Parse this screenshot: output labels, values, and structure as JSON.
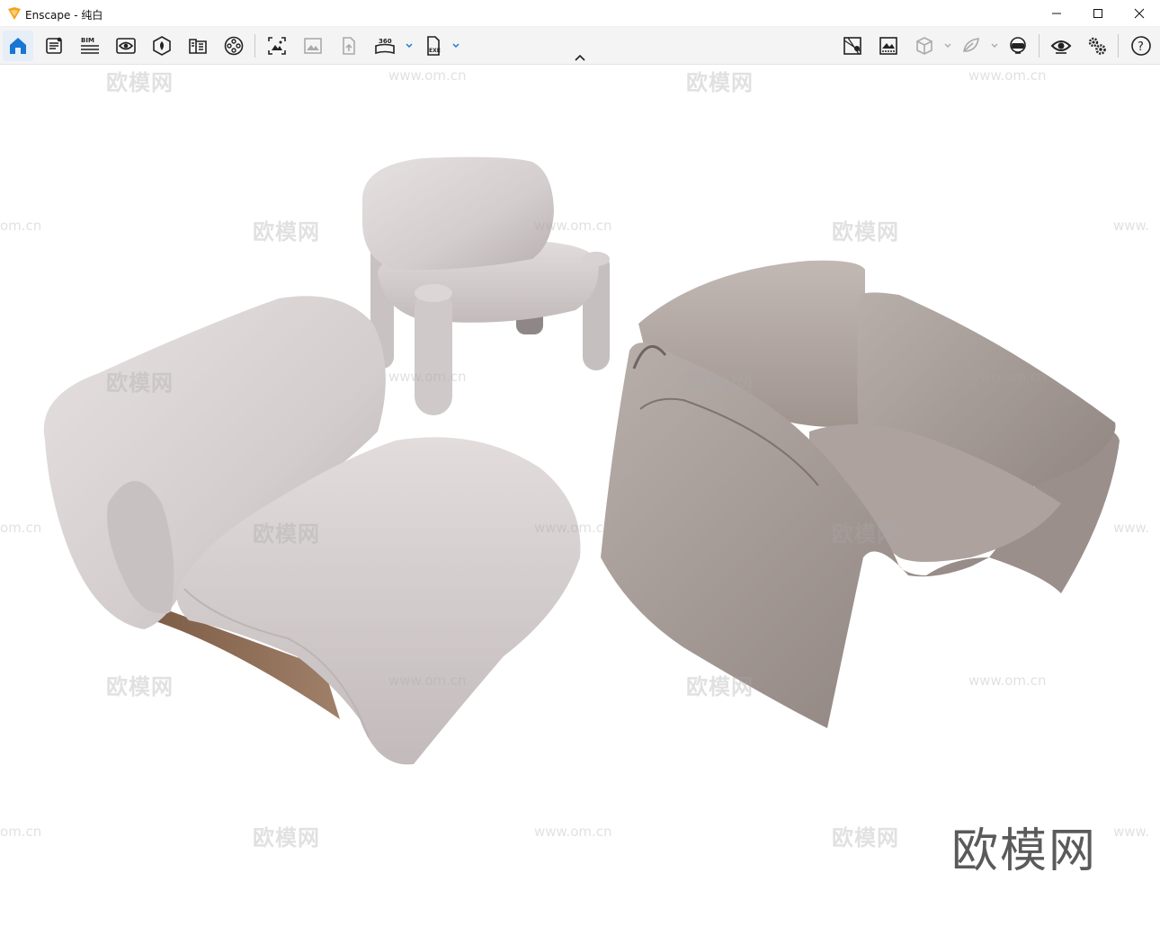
{
  "window": {
    "title": "Enscape - 纯白",
    "controls": [
      "minimize",
      "maximize",
      "close"
    ]
  },
  "toolbar": {
    "left_icons": [
      {
        "name": "home-icon",
        "active": true
      },
      {
        "name": "views-manager-icon"
      },
      {
        "name": "bim-icon",
        "label": "BIM"
      },
      {
        "name": "visual-settings-icon"
      },
      {
        "name": "asset-library-icon"
      },
      {
        "name": "material-editor-icon"
      },
      {
        "name": "video-editor-icon"
      },
      {
        "name": "screenshot-icon"
      },
      {
        "name": "batch-render-icon"
      },
      {
        "name": "upload-icon"
      },
      {
        "name": "panorama-icon",
        "label": "360"
      },
      {
        "name": "export-exe-icon",
        "label": "EXE"
      }
    ],
    "right_icons": [
      {
        "name": "map-icon"
      },
      {
        "name": "atmosphere-icon"
      },
      {
        "name": "section-box-icon"
      },
      {
        "name": "capture-icon"
      },
      {
        "name": "vr-headset-icon"
      },
      {
        "name": "eye-icon"
      },
      {
        "name": "settings-icon"
      },
      {
        "name": "help-icon",
        "label": "?"
      }
    ]
  },
  "watermark": {
    "brand_cn": "欧模网",
    "url": "www.om.cn",
    "partial_url_left": "om.cn",
    "partial_url_right": "www."
  },
  "colors": {
    "toolbar_bg": "#f4f4f4",
    "active_icon": "#1976d2",
    "chair_light": "#d8d2d2",
    "chair_taupe": "#a69c98",
    "wood": "#8b6a52"
  }
}
